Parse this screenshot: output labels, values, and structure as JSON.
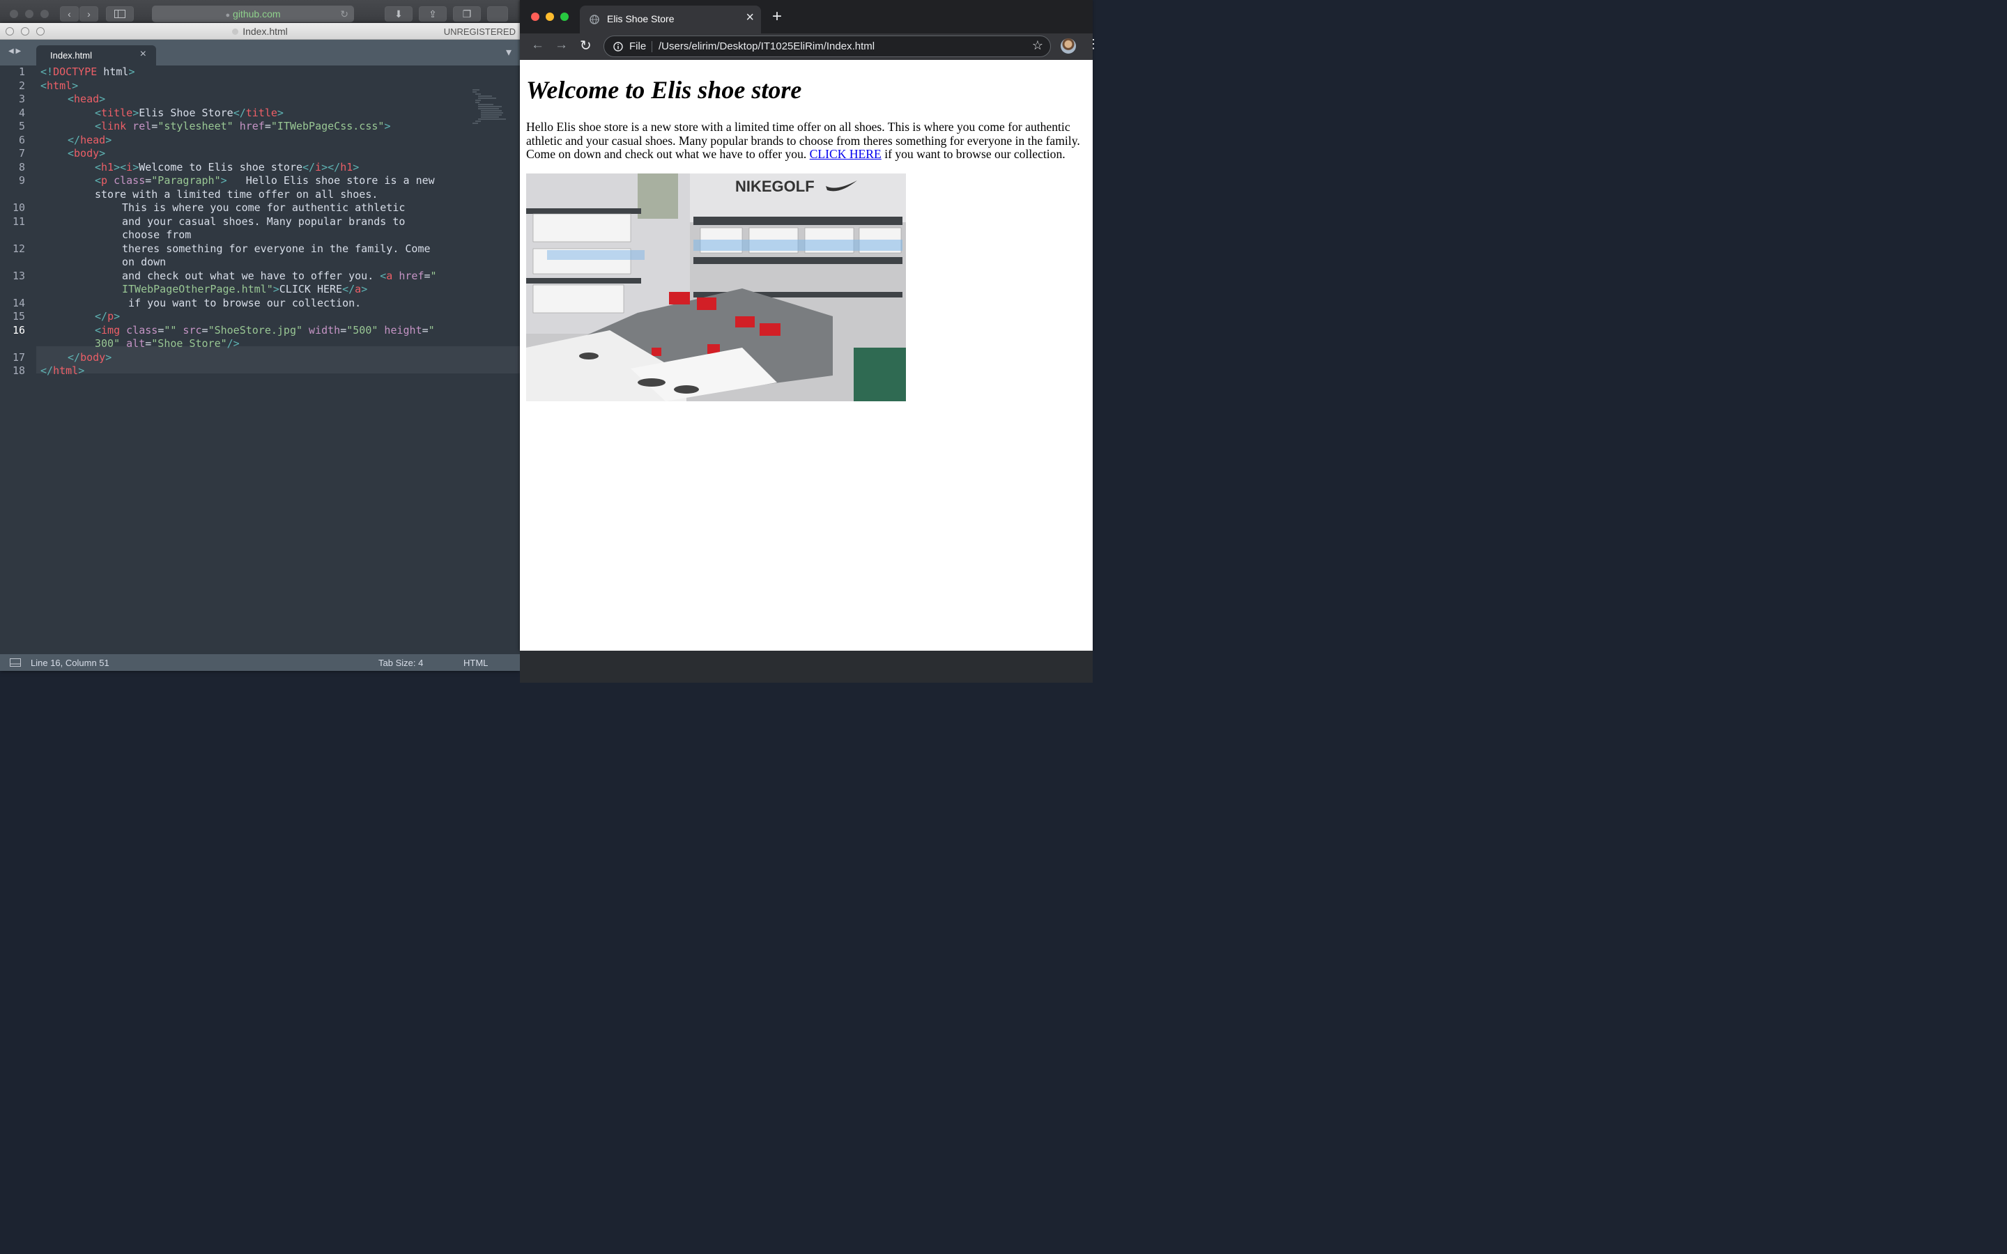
{
  "safari": {
    "address": "github.com",
    "lock_icon": "lock-icon",
    "reload_icon": "reload-icon",
    "back_icon": "chevron-left-icon",
    "forward_icon": "chevron-right-icon",
    "sidebar_icon": "sidebar-icon",
    "download_icon": "download-icon",
    "share_icon": "share-icon",
    "tabs_icon": "tabs-icon"
  },
  "editor": {
    "window_title": "Index.html",
    "registration": "UNREGISTERED",
    "tab_label": "Index.html",
    "tab_close": "×",
    "nav_arrows": "◀ ▶",
    "tab_menu": "▾",
    "status_position": "Line 16, Column 51",
    "status_tabsize": "Tab Size: 4",
    "status_syntax": "HTML",
    "line_numbers": [
      "1",
      "2",
      "3",
      "4",
      "5",
      "6",
      "7",
      "8",
      "9",
      "10",
      "11",
      "12",
      "13",
      "14",
      "15",
      "16",
      "17",
      "18"
    ],
    "code": {
      "l1": [
        "<!",
        "DOCTYPE",
        " html",
        ">"
      ],
      "l2": [
        "<",
        "html",
        ">"
      ],
      "l3": [
        "<",
        "head",
        ">"
      ],
      "l4": [
        "<",
        "title",
        ">",
        "Elis Shoe Store",
        "</",
        "title",
        ">"
      ],
      "l5": [
        "<",
        "link",
        " rel",
        "=",
        "\"stylesheet\"",
        " href",
        "=",
        "\"ITWebPageCss.css\"",
        ">"
      ],
      "l6": [
        "</",
        "head",
        ">"
      ],
      "l7": [
        "<",
        "body",
        ">"
      ],
      "l8": [
        "<",
        "h1",
        "><",
        "i",
        ">",
        "Welcome to Elis shoe store",
        "</",
        "i",
        "></",
        "h1",
        ">"
      ],
      "l9a": [
        "<",
        "p",
        " class",
        "=",
        "\"Paragraph\"",
        ">",
        "   Hello Elis shoe store is a new"
      ],
      "l9b": "store with a limited time offer on all shoes.",
      "l10": "This is where you come for authentic athletic",
      "l11a": "and your casual shoes. Many popular brands to",
      "l11b": "choose from",
      "l12a": "theres something for everyone in the family. Come",
      "l12b": "on down",
      "l13a": [
        "and check out what we have to offer you. ",
        "<",
        "a",
        " href",
        "=",
        "\""
      ],
      "l13b": [
        "ITWebPageOtherPage.html\"",
        ">",
        "CLICK HERE",
        "</",
        "a",
        ">"
      ],
      "l14": " if you want to browse our collection.",
      "l15": [
        "</",
        "p",
        ">"
      ],
      "l16a": [
        "<",
        "img",
        " class",
        "=",
        "\"\"",
        " src",
        "=",
        "\"ShoeStore.jpg\"",
        " width",
        "=",
        "\"500\"",
        " height",
        "=",
        "\""
      ],
      "l16b": [
        "300\"",
        " alt",
        "=",
        "\"Shoe Store\"",
        "/>"
      ],
      "l17": [
        "</",
        "body",
        ">"
      ],
      "l18": [
        "</",
        "html",
        ">"
      ]
    }
  },
  "chrome": {
    "tab_title": "Elis Shoe Store",
    "tab_close": "×",
    "new_tab": "+",
    "scheme": "File",
    "url": "/Users/elirim/Desktop/IT1025EliRim/Index.html",
    "globe_icon": "globe-icon",
    "info_icon": "info-icon",
    "star_icon": "star-icon",
    "avatar_icon": "avatar-icon",
    "menu_icon": "more-vertical-icon"
  },
  "page": {
    "heading": "Welcome to Elis shoe store",
    "para_before_link": "Hello Elis shoe store is a new store with a limited time offer on all shoes. This is where you come for authentic athletic and your casual shoes. Many popular brands to choose from theres something for everyone in the family. Come on down and check out what we have to offer you. ",
    "link_text": "CLICK HERE",
    "para_after_link": " if you want to browse our collection.",
    "image_alt": "Shoe Store",
    "image_sign_brand": "NIKEGOLF"
  },
  "colors": {
    "editor_bg": "#303841",
    "tag": "#5fb4b4",
    "tag_name": "#ec5f67",
    "attr": "#c594c5",
    "string": "#99c794",
    "link": "#0000ee"
  }
}
